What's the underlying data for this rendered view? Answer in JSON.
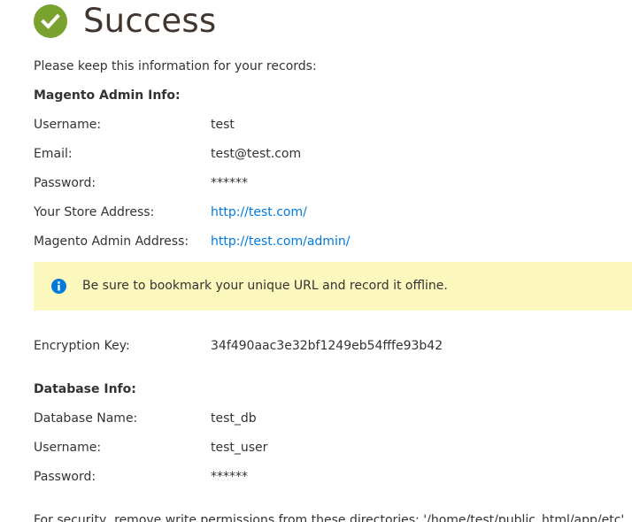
{
  "header": {
    "title": "Success"
  },
  "intro": "Please keep this information for your records:",
  "admin_info": {
    "heading": "Magento Admin Info:",
    "rows": [
      {
        "label": "Username:",
        "value": "test"
      },
      {
        "label": "Email:",
        "value": "test@test.com"
      },
      {
        "label": "Password:",
        "value": "******"
      },
      {
        "label": "Your Store Address:",
        "value": "http://test.com/"
      },
      {
        "label": "Magento Admin Address:",
        "value": "http://test.com/admin/"
      }
    ]
  },
  "notice": {
    "text": "Be sure to bookmark your unique URL and record it offline.",
    "icon": "info-icon"
  },
  "encryption": {
    "label": "Encryption Key:",
    "value": "34f490aac3e32bf1249eb54fffe93b42"
  },
  "database_info": {
    "heading": "Database Info:",
    "rows": [
      {
        "label": "Database Name:",
        "value": "test_db"
      },
      {
        "label": "Username:",
        "value": "test_user"
      },
      {
        "label": "Password:",
        "value": "******"
      }
    ]
  },
  "security_note": "For security, remove write permissions from these directories: '/home/test/public_html/app/etc'",
  "colors": {
    "success_green": "#79a22e",
    "link_blue": "#007bdb",
    "notice_bg": "#fdf8be",
    "info_blue": "#007bdb",
    "title": "#41362f"
  }
}
